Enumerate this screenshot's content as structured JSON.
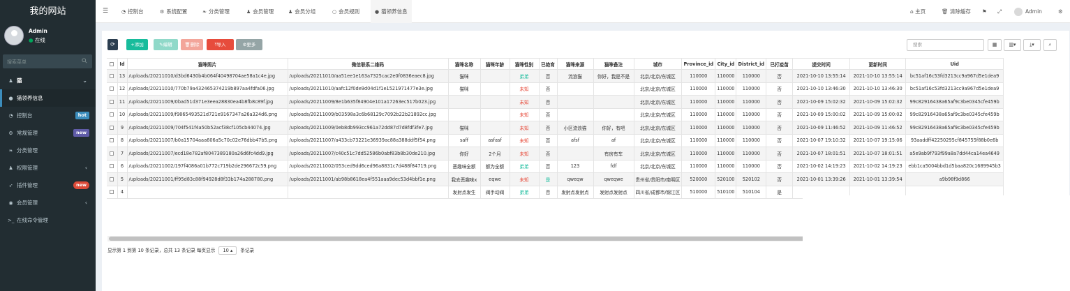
{
  "sidebar": {
    "logo": "我的网站",
    "user_name": "Admin",
    "user_status": "在线",
    "search_placeholder": "搜索菜单",
    "items": [
      {
        "label": "猫",
        "icon": "group-icon"
      },
      {
        "label": "猫领养信息",
        "icon": "chat-icon"
      },
      {
        "label": "控制台",
        "icon": "dashboard-icon",
        "badge": "hot"
      },
      {
        "label": "常规管理",
        "icon": "cogs-icon",
        "badge": "new"
      },
      {
        "label": "分类管理",
        "icon": "leaf-icon"
      },
      {
        "label": "权限管理",
        "icon": "group-icon"
      },
      {
        "label": "插件管理",
        "icon": "rocket-icon",
        "badge": "new"
      },
      {
        "label": "会员管理",
        "icon": "user-circle-icon"
      },
      {
        "label": "在线命令管理",
        "icon": "terminal-icon"
      }
    ]
  },
  "topnav": {
    "tabs": [
      "控制台",
      "系统配置",
      "分类管理",
      "会员管理",
      "会员分组",
      "会员规则",
      "猫领养信息"
    ],
    "right": [
      "主页",
      "清除缓存",
      "Admin"
    ]
  },
  "toolbar": {
    "refresh": "⟳",
    "add": "添加",
    "edit": "编辑",
    "delete": "删除",
    "import": "导入",
    "more": "更多",
    "search_placeholder": "搜索"
  },
  "table": {
    "headers": [
      "Id",
      "猫咪照片",
      "微信联系二维码",
      "猫咪名称",
      "猫咪年龄",
      "猫咪性别",
      "已绝育",
      "猫咪来源",
      "猫咪备注",
      "城市",
      "Province_id",
      "City_id",
      "District_id",
      "已打疫苗",
      "提交时间",
      "更新时间",
      "Uid"
    ],
    "rows": [
      [
        "13",
        "/uploads/20211010/d3bd6430b4b064f40498704ae58a1c4e.jpg",
        "/uploads/20211010/aa51ee1e163a7325cac2e0f0836eaec8.jpg",
        "猫咪",
        "",
        "弟弟",
        "否",
        "流浪猫",
        "你好，我是不是",
        "北京/北京/东城区",
        "110000",
        "110000",
        "110000",
        "否",
        "2021-10-10 13:55:14",
        "2021-10-10 13:55:14",
        "bc51af16c53fd3213cc9a967d5e1dea9"
      ],
      [
        "12",
        "/uploads/20211010/770b79a432465374219b897aa4fdfa06.jpg",
        "/uploads/20211010/aafc12f0de9d04d1f1e1521971477e3e.jpg",
        "猫咪",
        "",
        "未知",
        "否",
        "",
        "",
        "北京/北京/东城区",
        "110000",
        "110000",
        "110000",
        "否",
        "2021-10-10 13:46:30",
        "2021-10-10 13:46:30",
        "bc51af16c53fd3213cc9a967d5e1dea9"
      ],
      [
        "11",
        "/uploads/20211009/0bad51d371e3eea28830ea4b8fb8c89f.jpg",
        "/uploads/20211009/8e1b635f84904e101a17263ec517b023.jpg",
        "",
        "",
        "未知",
        "否",
        "",
        "",
        "北京/北京/东城区",
        "110000",
        "110000",
        "110000",
        "否",
        "2021-10-09 15:02:32",
        "2021-10-09 15:02:32",
        "99c82916438a65af9c3be0345cfe459b"
      ],
      [
        "10",
        "/uploads/20211009/f9865493521d721e9167347a26a324d6.png",
        "/uploads/20211009/b03598a3c6b68129c7092b22b21892cc.jpg",
        "",
        "",
        "未知",
        "否",
        "",
        "",
        "北京/北京/东城区",
        "110000",
        "110000",
        "110000",
        "否",
        "2021-10-09 15:00:02",
        "2021-10-09 15:00:02",
        "99c82916438a65af9c3be0345cfe459b"
      ],
      [
        "9",
        "/uploads/20211009/704f541f4a50b52acf38cf105cb44074.jpg",
        "/uploads/20211009/0eb8db993cc961a72dd87d7d8fdf3fe7.jpg",
        "猫咪",
        "",
        "未知",
        "否",
        "小区流浪猫",
        "你好，有吧",
        "北京/北京/东城区",
        "110000",
        "110000",
        "110000",
        "否",
        "2021-10-09 11:46:52",
        "2021-10-09 11:46:52",
        "99c82916438a65af9c3be0345cfe459b"
      ],
      [
        "8",
        "/uploads/20211007/b0a15704aaa606a5c70c02e76dbb47b5.png",
        "/uploads/20211007/a433cb73221e36939ac88a388ddf5f54.png",
        "saff",
        "asfasf",
        "未知",
        "否",
        "afsf",
        "af",
        "北京/北京/东城区",
        "110000",
        "110000",
        "110000",
        "否",
        "2021-10-07 19:10:32",
        "2021-10-07 19:15:06",
        "93aaddff42250295cf845755f88b0e6b"
      ],
      [
        "7",
        "/uploads/20211007/ecd18e782af8047389180a26d6fc4dd9.jpg",
        "/uploads/20211007/c40c51c7dd52586b0abf83b8b30de210.jpg",
        "你好",
        "2个月",
        "未知",
        "否",
        "",
        "有房有车",
        "北京/北京/东城区",
        "110000",
        "110000",
        "110000",
        "否",
        "2021-10-07 18:01:51",
        "2021-10-07 18:01:51",
        "a5e9ab9f793f99a8a7dd44ca14ea4649"
      ],
      [
        "6",
        "/uploads/20211002/197f4086a01b772c719b2de296672c59.png",
        "/uploads/20211002/053ced9dd6ced96a8831c7d488f84719.png",
        "恶趣味全额",
        "额为全额",
        "弟弟",
        "否",
        "123",
        "fdf",
        "北京/北京/东城区",
        "110000",
        "110000",
        "110000",
        "否",
        "2021-10-02 14:19:23",
        "2021-10-02 14:19:23",
        "ebb1ca5004bbd1d5baa820c1689945b3"
      ],
      [
        "5",
        "/uploads/20211001/ff95d83c88f94928d8f33b174a288780.png",
        "/uploads/20211001/ab98b8618ea4f551aaa9dec53d4bbf1e.png",
        "我去恶趣味x",
        "eqwe",
        "未知",
        "是",
        "qweqw",
        "qweqwe",
        "贵州省/贵阳市/南明区",
        "520000",
        "520100",
        "520102",
        "否",
        "2021-10-01 13:39:26",
        "2021-10-01 13:39:54",
        "a9b98f9d866"
      ],
      [
        "4",
        "",
        "",
        "发射点发生",
        "阀手动阀",
        "弟弟",
        "否",
        "发射点发射点",
        "发射点发射点",
        "四川省/成都市/锦江区",
        "510000",
        "510100",
        "510104",
        "是",
        "",
        "",
        ""
      ]
    ]
  },
  "pager": {
    "text_before": "显示第 1 到第 10 条记录，总共 13 条记录 每页显示",
    "page_size": "10",
    "text_after": "条记录"
  },
  "colors": {
    "sidebar_bg": "#222d32",
    "accent": "#3c8dbc",
    "success": "#18bc9c",
    "danger": "#e74c3c"
  }
}
